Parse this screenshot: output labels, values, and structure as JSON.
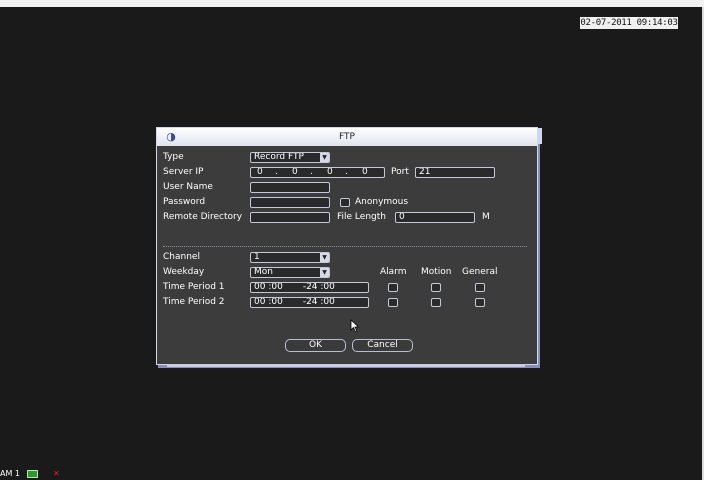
{
  "clock": "02-07-2011 09:14:03",
  "dialog": {
    "title": "FTP",
    "labels": {
      "type": "Type",
      "server_ip": "Server IP",
      "port": "Port",
      "user_name": "User Name",
      "password": "Password",
      "anonymous": "Anonymous",
      "remote_directory": "Remote Directory",
      "file_length": "File Length",
      "file_length_unit": "M",
      "channel": "Channel",
      "weekday": "Weekday",
      "alarm": "Alarm",
      "motion": "Motion",
      "general": "General",
      "time_period_1": "Time Period 1",
      "time_period_2": "Time Period 2"
    },
    "values": {
      "type": "Record FTP",
      "server_ip": [
        "0",
        "0",
        "0",
        "0"
      ],
      "port": "21",
      "user_name": "",
      "password": "",
      "remote_directory": "",
      "file_length": "0",
      "channel": "1",
      "weekday": "Mon",
      "time_period_1": "00 :00       -24 :00",
      "time_period_2": "00 :00       -24 :00"
    },
    "buttons": {
      "ok": "OK",
      "cancel": "Cancel"
    }
  },
  "statusbar": {
    "channel_label": "AM 1",
    "rec_icon": "record-indicator-icon",
    "alarm_icon": "alarm-x-icon"
  },
  "colors": {
    "background": "#1a1a1a",
    "dialog": "#3c3c3c",
    "border": "#c4c8dc"
  }
}
